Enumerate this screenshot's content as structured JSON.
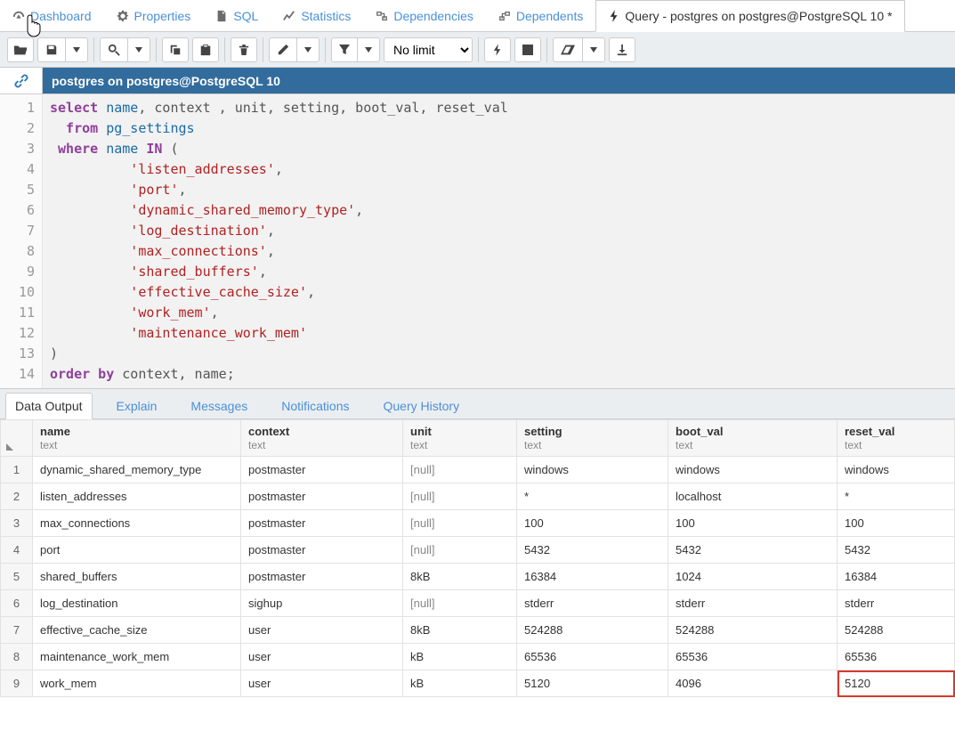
{
  "nav": {
    "dashboard": "Dashboard",
    "properties": "Properties",
    "sql": "SQL",
    "statistics": "Statistics",
    "dependencies": "Dependencies",
    "dependents": "Dependents",
    "query_tab": "Query - postgres on postgres@PostgreSQL 10 *"
  },
  "toolbar": {
    "limit_selected": "No limit"
  },
  "connection": {
    "label": "postgres on postgres@PostgreSQL 10"
  },
  "editor": {
    "lines": {
      "l1a": "select",
      "l1b": " name",
      "l1c": ", context , unit, setting, boot_val, reset_val",
      "l2a": "  from",
      "l2b": " pg_settings",
      "l3a": " where",
      "l3b": " name ",
      "l3c": "IN",
      "l3d": " (",
      "l4": "          'listen_addresses'",
      "l4p": ",",
      "l5": "          'port'",
      "l5p": ",",
      "l6": "          'dynamic_shared_memory_type'",
      "l6p": ",",
      "l7": "          'log_destination'",
      "l7p": ",",
      "l8": "          'max_connections'",
      "l8p": ",",
      "l9": "          'shared_buffers'",
      "l9p": ",",
      "l10": "          'effective_cache_size'",
      "l10p": ",",
      "l11": "          'work_mem'",
      "l11p": ",",
      "l12": "          'maintenance_work_mem'",
      "l13": ")",
      "l14a": "order by",
      "l14b": " context, name",
      "l14c": ";"
    },
    "linecount": 14
  },
  "result_tabs": {
    "data_output": "Data Output",
    "explain": "Explain",
    "messages": "Messages",
    "notifications": "Notifications",
    "query_history": "Query History"
  },
  "grid": {
    "columns": [
      {
        "name": "name",
        "type": "text"
      },
      {
        "name": "context",
        "type": "text"
      },
      {
        "name": "unit",
        "type": "text"
      },
      {
        "name": "setting",
        "type": "text"
      },
      {
        "name": "boot_val",
        "type": "text"
      },
      {
        "name": "reset_val",
        "type": "text"
      }
    ],
    "rows": [
      {
        "n": "1",
        "name": "dynamic_shared_memory_type",
        "context": "postmaster",
        "unit": "[null]",
        "setting": "windows",
        "boot_val": "windows",
        "reset_val": "windows"
      },
      {
        "n": "2",
        "name": "listen_addresses",
        "context": "postmaster",
        "unit": "[null]",
        "setting": "*",
        "boot_val": "localhost",
        "reset_val": "*"
      },
      {
        "n": "3",
        "name": "max_connections",
        "context": "postmaster",
        "unit": "[null]",
        "setting": "100",
        "boot_val": "100",
        "reset_val": "100"
      },
      {
        "n": "4",
        "name": "port",
        "context": "postmaster",
        "unit": "[null]",
        "setting": "5432",
        "boot_val": "5432",
        "reset_val": "5432"
      },
      {
        "n": "5",
        "name": "shared_buffers",
        "context": "postmaster",
        "unit": "8kB",
        "setting": "16384",
        "boot_val": "1024",
        "reset_val": "16384"
      },
      {
        "n": "6",
        "name": "log_destination",
        "context": "sighup",
        "unit": "[null]",
        "setting": "stderr",
        "boot_val": "stderr",
        "reset_val": "stderr"
      },
      {
        "n": "7",
        "name": "effective_cache_size",
        "context": "user",
        "unit": "8kB",
        "setting": "524288",
        "boot_val": "524288",
        "reset_val": "524288"
      },
      {
        "n": "8",
        "name": "maintenance_work_mem",
        "context": "user",
        "unit": "kB",
        "setting": "65536",
        "boot_val": "65536",
        "reset_val": "65536"
      },
      {
        "n": "9",
        "name": "work_mem",
        "context": "user",
        "unit": "kB",
        "setting": "5120",
        "boot_val": "4096",
        "reset_val": "5120"
      }
    ]
  }
}
